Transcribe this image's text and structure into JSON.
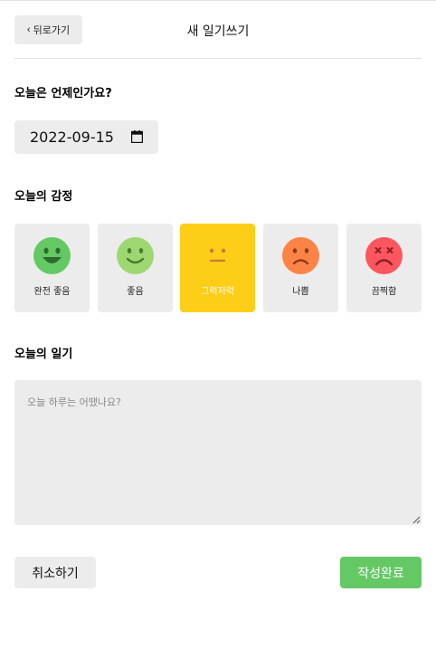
{
  "header": {
    "back_label": "뒤로가기",
    "title": "새 일기쓰기"
  },
  "date_section": {
    "title": "오늘은 언제인가요?",
    "value": "2022-09-15"
  },
  "emotion_section": {
    "title": "오늘의 감정",
    "items": [
      {
        "label": "완전 좋음",
        "color": "#64c964",
        "selected": false
      },
      {
        "label": "좋음",
        "color": "#9dd772",
        "selected": false
      },
      {
        "label": "그럭저럭",
        "color": "#fdce17",
        "selected": true
      },
      {
        "label": "나쁨",
        "color": "#fd8446",
        "selected": false
      },
      {
        "label": "끔찍함",
        "color": "#fd565f",
        "selected": false
      }
    ]
  },
  "diary_section": {
    "title": "오늘의 일기",
    "placeholder": "오늘 하루는 어땠나요?"
  },
  "footer": {
    "cancel_label": "취소하기",
    "submit_label": "작성완료"
  },
  "colors": {
    "accent_green": "#64c964",
    "selected_yellow": "#fdce17",
    "button_gray": "#ececec"
  }
}
